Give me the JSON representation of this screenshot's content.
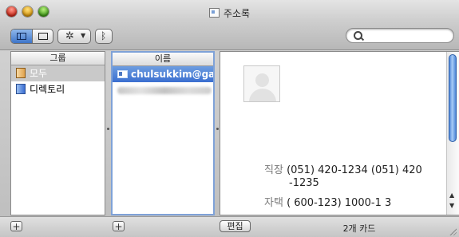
{
  "window": {
    "title": "주소록"
  },
  "toolbar": {
    "view_icons": [
      "columns-view-icon",
      "card-only-view-icon"
    ],
    "action_icon": "gear-icon",
    "bluetooth_icon": "bluetooth-icon",
    "search": {
      "value": "",
      "placeholder": ""
    }
  },
  "groups": {
    "header": "그룹",
    "items": [
      {
        "label": "모두",
        "selected": true
      },
      {
        "label": "디렉토리",
        "selected": false
      }
    ]
  },
  "names": {
    "header": "이름",
    "items": [
      {
        "label": "chulsukkim@gan",
        "selected": true
      }
    ]
  },
  "card": {
    "fields": [
      {
        "label": "직장",
        "value": "(051) 420-1234 (051) 420",
        "cont": "-1235"
      },
      {
        "label": "자택",
        "value": "( 600-123) 1000-1 3"
      }
    ]
  },
  "bottom": {
    "add_group": "+",
    "add_name": "+",
    "edit_label": "편집",
    "count_label": "2개 카드"
  },
  "colors": {
    "selection_blue": "#3b6fd0",
    "selection_gray": "#c9c9c9",
    "scroll_thumb": "#4e86d8"
  }
}
